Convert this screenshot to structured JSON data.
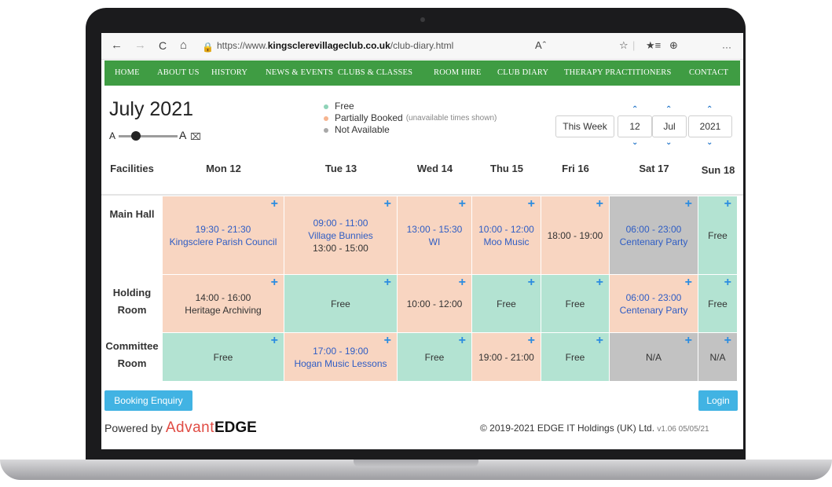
{
  "browser": {
    "back": "←",
    "forward": "→",
    "reload": "C",
    "home": "⌂",
    "url_prefix": "https://www.",
    "url_domain": "kingsclerevillageclub.co.uk",
    "url_path": "/club-diary.html",
    "more": "···"
  },
  "nav": [
    "HOME",
    "ABOUT US",
    "HISTORY",
    "NEWS & EVENTS",
    "CLUBS & CLASSES",
    "ROOM HIRE",
    "CLUB DIARY",
    "THERAPY PRACTITIONERS",
    "CONTACT"
  ],
  "header": {
    "title": "July 2021",
    "slider_small": "A",
    "slider_large": "A"
  },
  "legend": {
    "free": "Free",
    "partial": "Partially Booked",
    "partial_note": "(unavailable times shown)",
    "na": "Not Available",
    "colors": {
      "free": "#8fd3b8",
      "partial": "#f6b48f",
      "na": "#a8a8a8"
    }
  },
  "controls": {
    "this_week": "This Week",
    "day": "12",
    "month": "Jul",
    "year": "2021"
  },
  "grid": {
    "facilities_label": "Facilities",
    "days": [
      "Mon 12",
      "Tue 13",
      "Wed 14",
      "Thu 15",
      "Fri 16",
      "Sat 17",
      "Sun 18"
    ],
    "rows": [
      {
        "label_1": "Main Hall",
        "label_2": "",
        "cells": [
          {
            "status": "partial",
            "line1": "19:30 - 21:30",
            "line2": "Kingsclere Parish Council",
            "line3": "",
            "linked": true
          },
          {
            "status": "partial",
            "line1": "09:00 - 11:00",
            "line2": "Village Bunnies",
            "line3": "13:00 - 15:00",
            "linked": true
          },
          {
            "status": "partial",
            "line1": "13:00 - 15:30",
            "line2": "WI",
            "line3": "",
            "linked": true
          },
          {
            "status": "partial",
            "line1": "10:00 - 12:00",
            "line2": "Moo Music",
            "line3": "",
            "linked": true
          },
          {
            "status": "partial",
            "line1": "18:00 - 19:00",
            "line2": "",
            "line3": "",
            "linked": false
          },
          {
            "status": "na",
            "line1": "06:00 - 23:00",
            "line2": "Centenary Party",
            "line3": "",
            "linked": true
          },
          {
            "status": "free",
            "line1": "Free",
            "line2": "",
            "line3": "",
            "linked": false
          }
        ]
      },
      {
        "label_1": "Holding",
        "label_2": "Room",
        "cells": [
          {
            "status": "partial",
            "line1": "14:00 - 16:00",
            "line2": "Heritage Archiving",
            "line3": "",
            "linked": false
          },
          {
            "status": "free",
            "line1": "Free",
            "line2": "",
            "line3": "",
            "linked": false
          },
          {
            "status": "partial",
            "line1": "10:00 - 12:00",
            "line2": "",
            "line3": "",
            "linked": false
          },
          {
            "status": "free",
            "line1": "Free",
            "line2": "",
            "line3": "",
            "linked": false
          },
          {
            "status": "free",
            "line1": "Free",
            "line2": "",
            "line3": "",
            "linked": false
          },
          {
            "status": "partial",
            "line1": "06:00 - 23:00",
            "line2": "Centenary Party",
            "line3": "",
            "linked": true
          },
          {
            "status": "free",
            "line1": "Free",
            "line2": "",
            "line3": "",
            "linked": false
          }
        ]
      },
      {
        "label_1": "Committee",
        "label_2": "Room",
        "cells": [
          {
            "status": "free",
            "line1": "Free",
            "line2": "",
            "line3": "",
            "linked": false
          },
          {
            "status": "partial",
            "line1": "17:00 - 19:00",
            "line2": "Hogan Music Lessons",
            "line3": "",
            "linked": true
          },
          {
            "status": "free",
            "line1": "Free",
            "line2": "",
            "line3": "",
            "linked": false
          },
          {
            "status": "partial",
            "line1": "19:00 - 21:00",
            "line2": "",
            "line3": "",
            "linked": false
          },
          {
            "status": "free",
            "line1": "Free",
            "line2": "",
            "line3": "",
            "linked": false
          },
          {
            "status": "na",
            "line1": "N/A",
            "line2": "",
            "line3": "",
            "linked": false
          },
          {
            "status": "na",
            "line1": "N/A",
            "line2": "",
            "line3": "",
            "linked": false
          }
        ]
      }
    ]
  },
  "footer": {
    "booking_button": "Booking Enquiry",
    "login_button": "Login",
    "powered_by": "Powered by",
    "brand_a": "Advant",
    "brand_b": "EDGE",
    "copyright": "© 2019-2021 EDGE IT Holdings (UK) Ltd.",
    "version": "v1.06 05/05/21"
  }
}
